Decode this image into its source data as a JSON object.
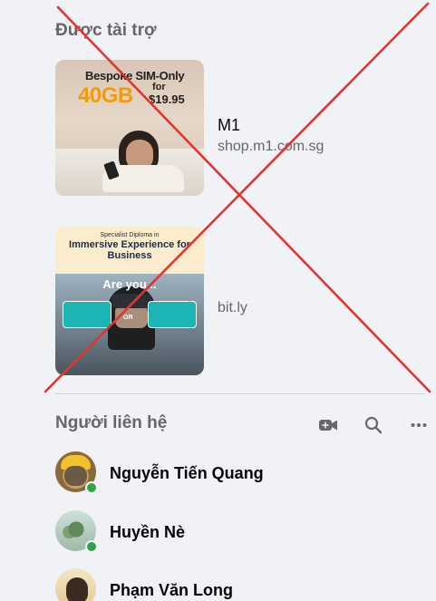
{
  "sponsored": {
    "title": "Được tài trợ",
    "ads": [
      {
        "name": "M1",
        "domain": "shop.m1.com.sg",
        "image_text": {
          "line1": "Bespoke SIM-Only",
          "big": "40GB",
          "for": "for",
          "price": "$19.95"
        }
      },
      {
        "name": "",
        "domain": "bit.ly",
        "image_text": {
          "small": "Specialist Diploma in",
          "headline": "Immersive Experience for Business",
          "are_you": "Are you...",
          "or": "OR"
        }
      }
    ]
  },
  "contacts": {
    "title": "Người liên hệ",
    "actions": [
      "new-video-room-icon",
      "search-icon",
      "more-options-icon"
    ],
    "items": [
      {
        "name": "Nguyễn Tiến Quang",
        "online": true
      },
      {
        "name": "Huyền Nè",
        "online": true
      },
      {
        "name": "Phạm Văn Long",
        "online": false
      }
    ]
  },
  "colors": {
    "background": "#f0f2f5",
    "secondary_text": "#65676b",
    "online": "#31a24c",
    "cross_overlay": "#e3342f"
  }
}
